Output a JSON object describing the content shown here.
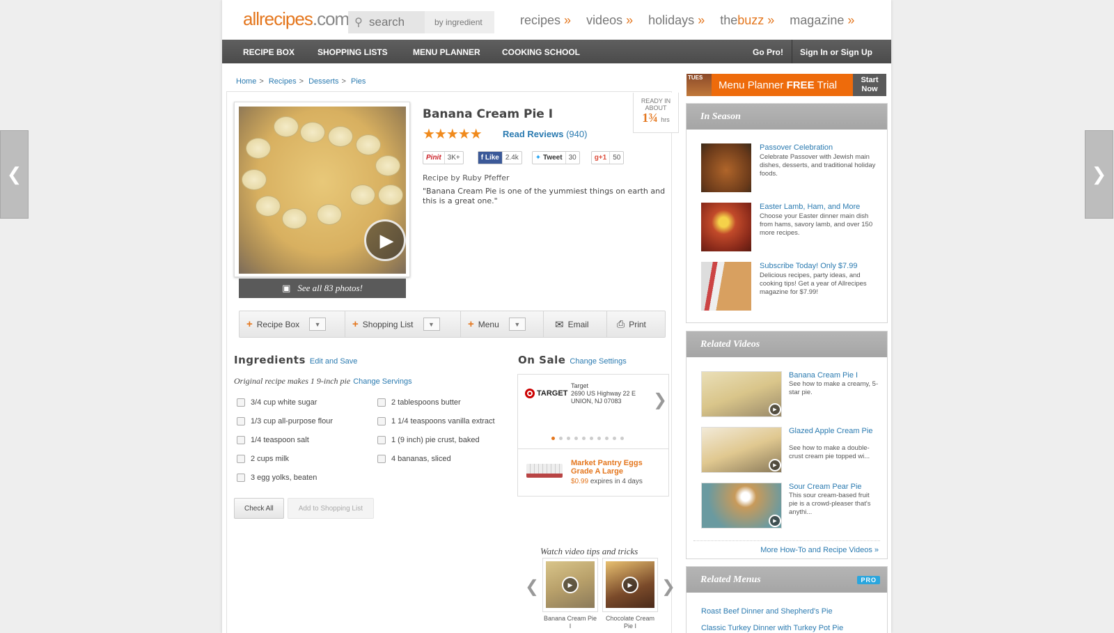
{
  "header": {
    "logo": "allrecipes",
    "logo_dot": ".",
    "logo_com": "com",
    "search_placeholder": "search",
    "search_by": "by ingredient",
    "nav": [
      {
        "label": "recipes",
        "arrow": "»"
      },
      {
        "label": "videos",
        "arrow": "»"
      },
      {
        "label": "holidays",
        "arrow": "»"
      },
      {
        "label_a": "the",
        "label_b": "buzz",
        "arrow": "»"
      },
      {
        "label": "magazine",
        "arrow": "»"
      }
    ]
  },
  "subnav": {
    "items": [
      "RECIPE BOX",
      "SHOPPING LISTS",
      "MENU PLANNER",
      "COOKING SCHOOL"
    ],
    "gopro": "Go Pro!",
    "signin": "Sign In or Sign Up"
  },
  "breadcrumb": [
    "Home",
    "Recipes",
    "Desserts",
    "Pies"
  ],
  "breadcrumb_sep": ">",
  "side_arrows": {
    "left": "❮",
    "right": "❯"
  },
  "recipe": {
    "title": "Banana Cream Pie I",
    "rating": 4.5,
    "stars": "★★★★★",
    "read_reviews": "Read Reviews",
    "reviews_count": "(940)",
    "recipe_by": "Recipe by Ruby Pfeffer",
    "description": "\"Banana Cream Pie is one of the yummiest things on earth and this is a great one.\"",
    "ready_label_1": "READY IN",
    "ready_label_2": "ABOUT",
    "ready_value": "1¾",
    "ready_unit": "hrs",
    "see_all_photos": "See all 83 photos!",
    "play_icon": "▶"
  },
  "social": {
    "pinit": "Pinit",
    "pin_count": "3K+",
    "like": "Like",
    "like_count": "2.4k",
    "tweet": "Tweet",
    "tweet_count": "30",
    "gplus": "g+1",
    "gplus_count": "50"
  },
  "toolbar": {
    "recipe_box": "Recipe Box",
    "shopping_list": "Shopping List",
    "menu": "Menu",
    "email": "Email",
    "print": "Print",
    "plus": "+",
    "dropdown": "▼"
  },
  "ingredients": {
    "heading": "Ingredients",
    "edit": "Edit and Save",
    "makes": "Original recipe makes 1 9-inch pie",
    "change_servings": "Change Servings",
    "col1": [
      "3/4 cup white sugar",
      "1/3 cup all-purpose flour",
      "1/4 teaspoon salt",
      "2 cups milk",
      "3 egg yolks, beaten"
    ],
    "col2": [
      "2 tablespoons butter",
      "1 1/4 teaspoons vanilla extract",
      "1 (9 inch) pie crust, baked",
      "4 bananas, sliced"
    ],
    "check_all": "Check All",
    "add_to_list": "Add to Shopping List"
  },
  "on_sale": {
    "heading": "On Sale",
    "change": "Change Settings",
    "store": "TARGET",
    "addr1": "Target",
    "addr2": "2690 US Highway 22 E",
    "addr3": "UNION, NJ 07083",
    "next": "❯",
    "deal_name": "Market Pantry Eggs Grade A Large",
    "deal_price": "$0.99",
    "deal_expires": "expires in 4 days"
  },
  "watch": {
    "heading": "Watch video tips and tricks",
    "videos": [
      "Banana Cream Pie I",
      "Chocolate Cream Pie I"
    ],
    "prev": "❮",
    "next": "❯"
  },
  "promo": {
    "tag": "TUES",
    "text_a": "Menu Planner ",
    "text_b": "FREE",
    "text_c": " Trial",
    "start": "Start Now"
  },
  "in_season": {
    "heading": "In Season",
    "items": [
      {
        "title": "Passover Celebration",
        "desc": "Celebrate Passover with Jewish main dishes, desserts, and traditional holiday foods."
      },
      {
        "title": "Easter Lamb, Ham, and More",
        "desc": "Choose your Easter dinner main dish from hams, savory lamb, and over 150 more recipes."
      },
      {
        "title": "Subscribe Today! Only $7.99",
        "desc": "Delicious recipes, party ideas, and cooking tips! Get a year of Allrecipes magazine for $7.99!"
      }
    ]
  },
  "related_videos": {
    "heading": "Related Videos",
    "items": [
      {
        "title": "Banana Cream Pie I",
        "desc": "See how to make a creamy, 5-star pie."
      },
      {
        "title": "Glazed Apple Cream Pie",
        "desc": "See how to make a double-crust cream pie topped wi..."
      },
      {
        "title": "Sour Cream Pear Pie",
        "desc": "This sour cream-based fruit pie is a crowd-pleaser that's anythi..."
      }
    ],
    "more": "More How-To and Recipe Videos »"
  },
  "related_menus": {
    "heading": "Related Menus",
    "badge": "PRO",
    "items": [
      "Roast Beef Dinner and Shepherd's Pie",
      "Classic Turkey Dinner with Turkey Pot Pie"
    ]
  },
  "colors": {
    "accent": "#e4761d",
    "link": "#2a7ab0",
    "nav_bg": "#4b4b4b"
  }
}
